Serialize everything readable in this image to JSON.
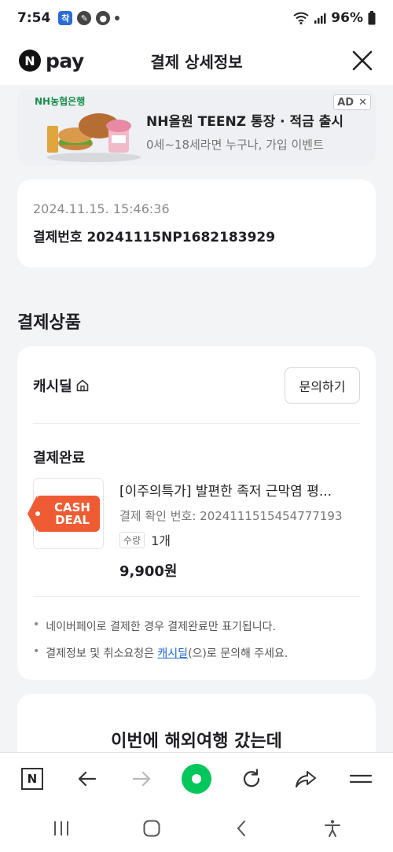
{
  "status_bar": {
    "time": "7:54",
    "battery": "96%"
  },
  "header": {
    "logo_mark": "N",
    "logo_text": "pay",
    "title": "결제 상세정보"
  },
  "ad": {
    "brand": "NH농협은행",
    "title": "NH올원 TEENZ 통장 · 적금 출시",
    "subtitle": "0세~18세라면 누구나, 가입 이벤트",
    "badge": "AD",
    "close": "✕"
  },
  "payment": {
    "datetime": "2024.11.15. 15:46:36",
    "number_label": "결제번호 20241115NP1682183929"
  },
  "section": {
    "title": "결제상품"
  },
  "product_card": {
    "seller": "캐시딜",
    "inquiry_button": "문의하기",
    "status": "결제완료",
    "thumb_line1": "CASH",
    "thumb_line2": "DEAL",
    "name": "[이주의특가] 발편한 족저 근막염 평...",
    "confirm": "결제 확인 번호: 2024111515454777193",
    "qty_label": "수량",
    "qty_value": "1개",
    "price": "9,900원",
    "note1": "네이버페이로 결제한 경우 결제완료만 표기됩니다.",
    "note2_before": "결제정보 및 취소요청은 ",
    "note2_link": "캐시딜",
    "note2_after": "(으)로 문의해 주세요."
  },
  "promo": {
    "title": "이번에 해외여행 갔는데"
  },
  "browser_nav": {
    "home_mark": "N"
  },
  "colors": {
    "green": "#03c75a",
    "deal_orange": "#ef5b33",
    "link_blue": "#1a66d2"
  }
}
